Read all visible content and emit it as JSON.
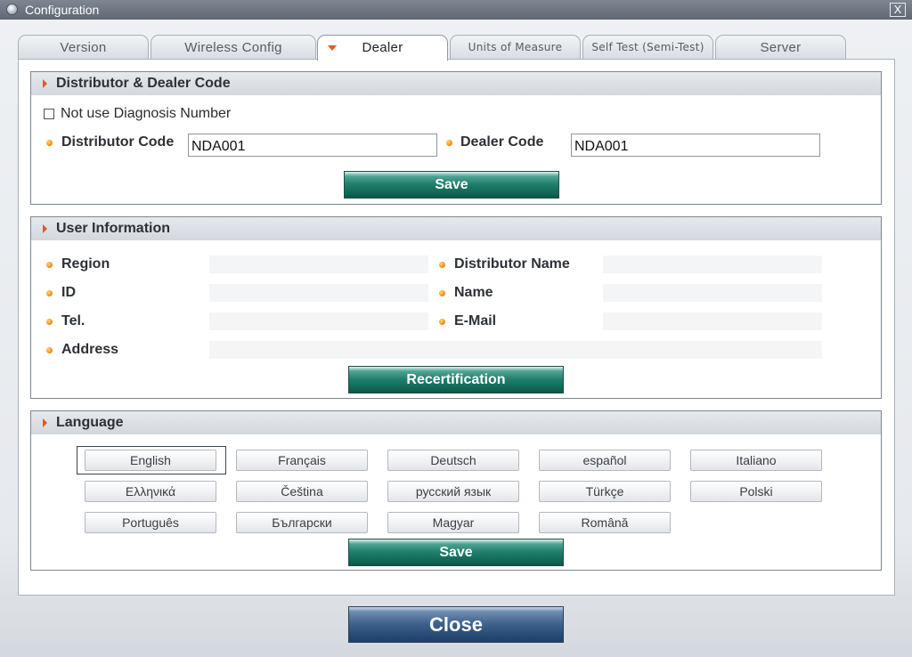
{
  "window": {
    "title": "Configuration",
    "close_label": "X"
  },
  "tabs": [
    {
      "label": "Version",
      "active": false
    },
    {
      "label": "Wireless Config",
      "active": false
    },
    {
      "label": "Dealer",
      "active": true
    },
    {
      "label": "Units of Measure",
      "active": false
    },
    {
      "label": "Self Test (Semi-Test)",
      "active": false
    },
    {
      "label": "Server",
      "active": false
    }
  ],
  "dealer_code": {
    "header": "Distributor & Dealer Code",
    "not_use_label": "Not use Diagnosis Number",
    "not_use_checked": false,
    "distributor_label": "Distributor Code",
    "distributor_value": "NDA001",
    "dealer_label": "Dealer Code",
    "dealer_value": "NDA001",
    "save_label": "Save"
  },
  "user_info": {
    "header": "User Information",
    "region_label": "Region",
    "region_value": "",
    "distributor_name_label": "Distributor Name",
    "distributor_name_value": "",
    "id_label": "ID",
    "id_value": "",
    "name_label": "Name",
    "name_value": "",
    "tel_label": "Tel.",
    "tel_value": "",
    "email_label": "E-Mail",
    "email_value": "",
    "address_label": "Address",
    "address_value": "",
    "recert_label": "Recertification"
  },
  "language": {
    "header": "Language",
    "selected": "English",
    "options": [
      "English",
      "Français",
      "Deutsch",
      "español",
      "Italiano",
      "Ελληνικά",
      "Čeština",
      "русский язык",
      "Türkçe",
      "Polski",
      "Português",
      "Български",
      "Magyar",
      "Română"
    ],
    "save_label": "Save"
  },
  "footer": {
    "close_label": "Close"
  },
  "colors": {
    "accent_orange": "#e8571b",
    "save_green": "#1f7f6b",
    "close_blue": "#274a74"
  }
}
